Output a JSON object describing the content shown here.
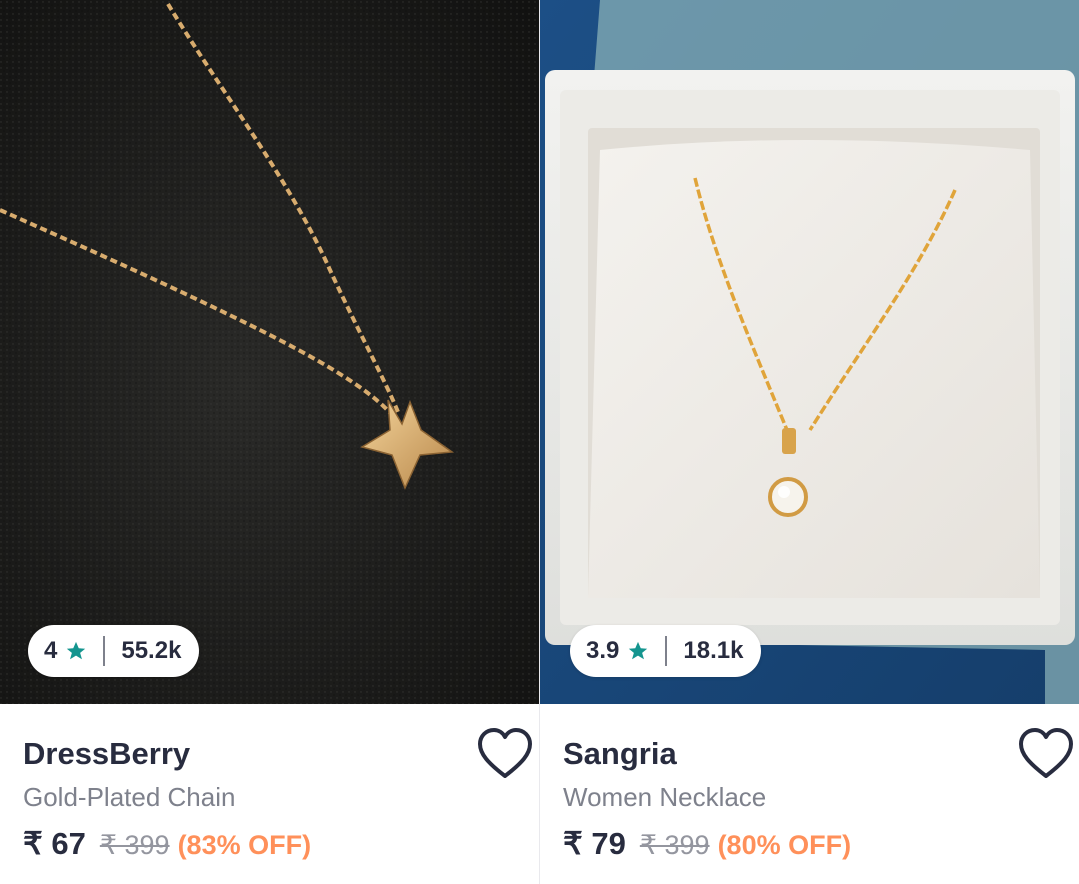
{
  "products": [
    {
      "brand": "DressBerry",
      "name": "Gold-Plated Chain",
      "rating": "4",
      "rating_count": "55.2k",
      "price": "₹ 67",
      "mrp": "₹ 399",
      "discount": "(83% OFF)",
      "image_icon": "star-pendant-necklace-image"
    },
    {
      "brand": "Sangria",
      "name": "Women Necklace",
      "rating": "3.9",
      "rating_count": "18.1k",
      "price": "₹ 79",
      "mrp": "₹ 399",
      "discount": "(80% OFF)",
      "image_icon": "solitaire-pendant-necklace-image"
    }
  ],
  "colors": {
    "text_primary": "#282c3f",
    "text_secondary": "#7e818c",
    "mrp": "#94969f",
    "discount": "#ff905a",
    "rating_star": "#14958f"
  },
  "icons": {
    "rating": "star-icon",
    "wishlist": "heart-outline-icon"
  }
}
